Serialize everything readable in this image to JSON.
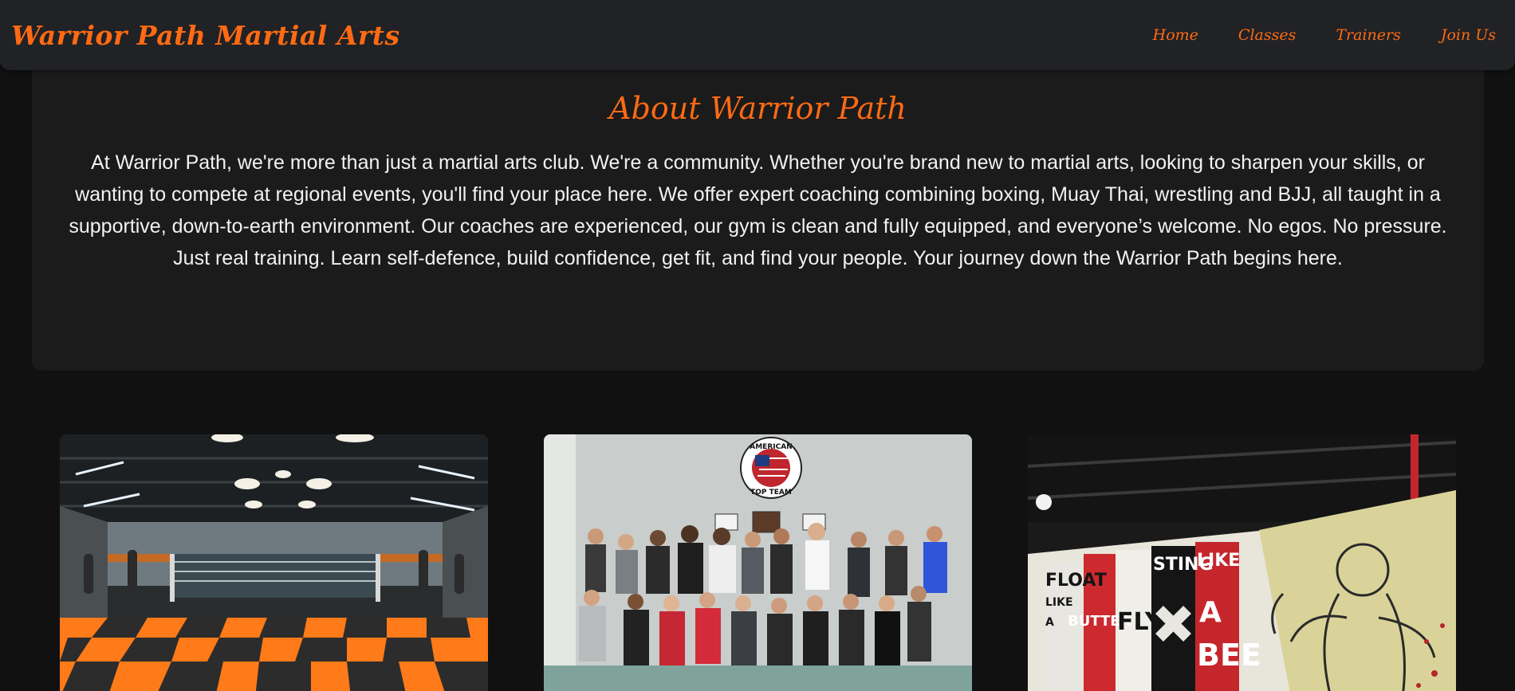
{
  "header": {
    "brand": "Warrior Path Martial Arts",
    "nav": [
      {
        "label": "Home"
      },
      {
        "label": "Classes"
      },
      {
        "label": "Trainers"
      },
      {
        "label": "Join Us"
      }
    ]
  },
  "about": {
    "title": "About Warrior Path",
    "body": "At Warrior Path, we're more than just a martial arts club. We're a community. Whether you're brand new to martial arts, looking to sharpen your skills, or wanting to compete at regional events, you'll find your place here. We offer expert coaching combining boxing, Muay Thai, wrestling and BJJ, all taught in a supportive, down-to-earth environment. Our coaches are experienced, our gym is clean and fully equipped, and everyone’s welcome. No egos. No pressure. Just real training. Learn self-defence, build confidence, get fit, and find your people. Your journey down the Warrior Path begins here."
  },
  "gallery": {
    "team_logo_line1": "AMERICAN",
    "team_logo_line2": "TOP TEAM",
    "mural_words": [
      "FLOAT",
      "LIKE",
      "A",
      "BUTTER",
      "FLY",
      "STING",
      "LIKE",
      "A",
      "BEE"
    ]
  },
  "colors": {
    "accent": "#ff6a13",
    "background": "#111111",
    "card": "#1b1b1b",
    "header": "#202225"
  }
}
